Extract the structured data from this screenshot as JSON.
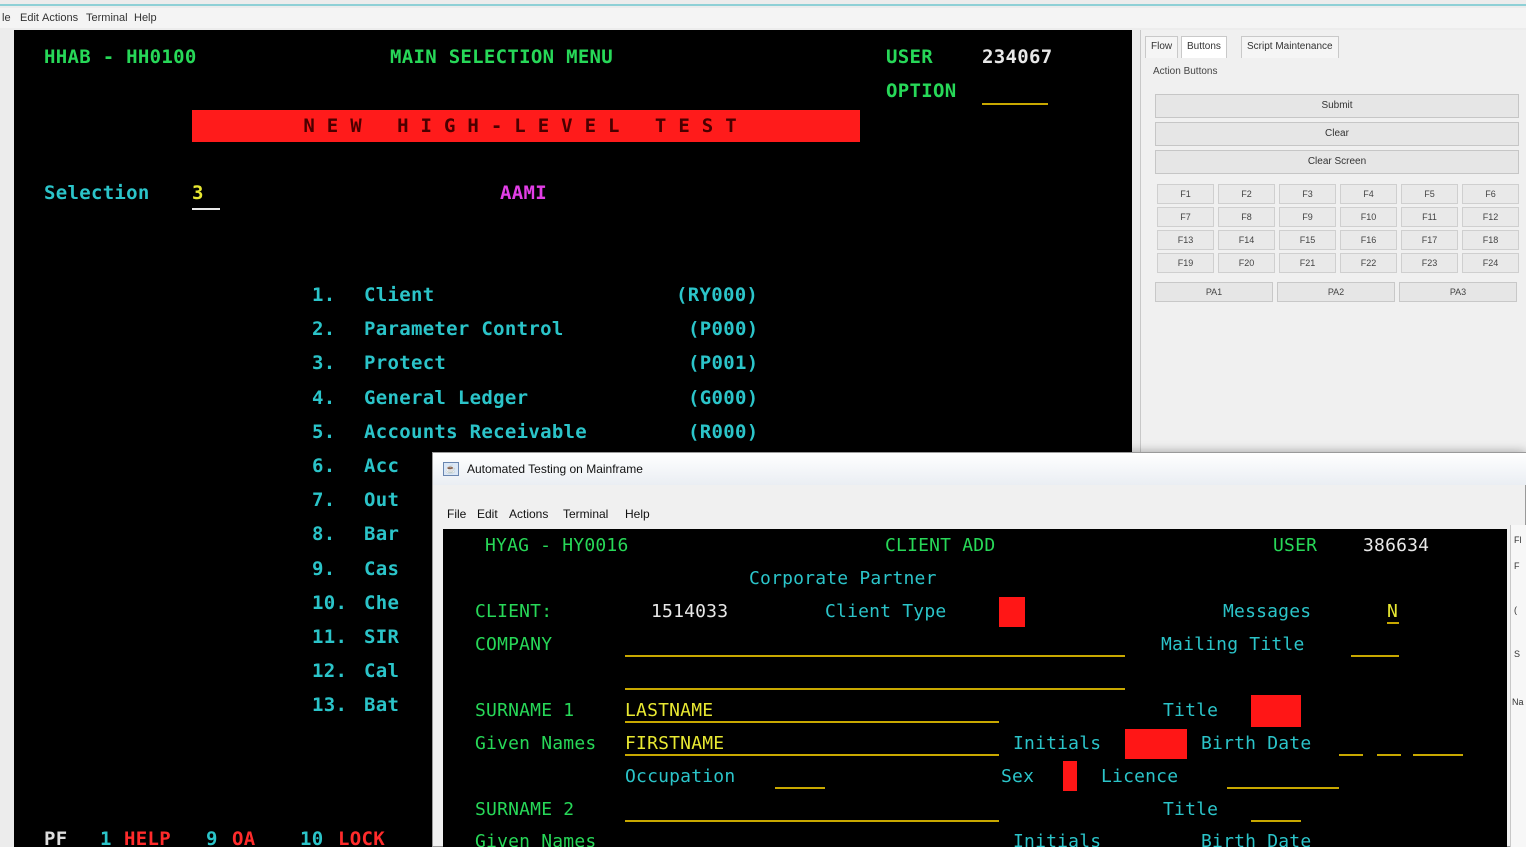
{
  "back_window": {
    "menu": [
      "le",
      "Edit",
      "Actions",
      "Terminal",
      "Help"
    ],
    "terminal": {
      "system_id": "HHAB - HH0100",
      "screen_title": "MAIN SELECTION MENU",
      "user_label": "USER",
      "user_value": "234067",
      "option_label": "OPTION",
      "banner": "NEW HIGH-LEVEL TEST",
      "selection_label": "Selection",
      "selection_value": "3",
      "aami_label": "AAMI",
      "menu_items": [
        {
          "num": "1.",
          "label": "Client",
          "code": "(RY000)"
        },
        {
          "num": "2.",
          "label": "Parameter Control",
          "code": "(P000)"
        },
        {
          "num": "3.",
          "label": "Protect",
          "code": "(P001)"
        },
        {
          "num": "4.",
          "label": "General Ledger",
          "code": "(G000)"
        },
        {
          "num": "5.",
          "label": "Accounts Receivable",
          "code": "(R000)"
        },
        {
          "num": "6.",
          "label": "Acc",
          "code": ""
        },
        {
          "num": "7.",
          "label": "Out",
          "code": ""
        },
        {
          "num": "8.",
          "label": "Bar",
          "code": ""
        },
        {
          "num": "9.",
          "label": "Cas",
          "code": ""
        },
        {
          "num": "10.",
          "label": "Che",
          "code": ""
        },
        {
          "num": "11.",
          "label": "SIR",
          "code": ""
        },
        {
          "num": "12.",
          "label": "Cal",
          "code": ""
        },
        {
          "num": "13.",
          "label": "Bat",
          "code": ""
        }
      ],
      "pf_label": "PF",
      "pf_keys": [
        {
          "num": "1",
          "label": "HELP"
        },
        {
          "num": "9",
          "label": "OA"
        },
        {
          "num": "10",
          "label": "LOCK"
        }
      ]
    },
    "panel": {
      "tabs": [
        "Flow",
        "Buttons",
        "Script Maintenance"
      ],
      "active_tab": "Buttons",
      "section_label": "Action Buttons",
      "wide_buttons": [
        "Submit",
        "Clear",
        "Clear Screen"
      ],
      "fkeys": [
        "F1",
        "F2",
        "F3",
        "F4",
        "F5",
        "F6",
        "F7",
        "F8",
        "F9",
        "F10",
        "F11",
        "F12",
        "F13",
        "F14",
        "F15",
        "F16",
        "F17",
        "F18",
        "F19",
        "F20",
        "F21",
        "F22",
        "F23",
        "F24"
      ],
      "pa_keys": [
        "PA1",
        "PA2",
        "PA3"
      ]
    }
  },
  "front_window": {
    "title": "Automated Testing on Mainframe",
    "menu": [
      "File",
      "Edit",
      "Actions",
      "Terminal",
      "Help"
    ],
    "terminal": {
      "system_id": "HYAG - HY0016",
      "screen_title": "CLIENT ADD",
      "user_label": "USER",
      "user_value": "386634",
      "subtitle": "Corporate Partner",
      "client_label": "CLIENT:",
      "client_value": "1514033",
      "client_type_label": "Client Type",
      "messages_label": "Messages",
      "messages_value": "N",
      "company_label": "COMPANY",
      "mailing_title_label": "Mailing Title",
      "surname1_label": "SURNAME 1",
      "surname1_value": "LASTNAME",
      "title_label": "Title",
      "given_names_label": "Given Names",
      "given_names_value": "FIRSTNAME",
      "initials_label": "Initials",
      "birth_date_label": "Birth Date",
      "occupation_label": "Occupation",
      "sex_label": "Sex",
      "licence_label": "Licence",
      "surname2_label": "SURNAME 2",
      "title2_label": "Title",
      "given_names2_label": "Given Names",
      "initials2_label": "Initials",
      "birth_date2_label": "Birth Date"
    },
    "side_fragments": [
      "Fl",
      "F",
      "(",
      "S",
      "Na"
    ]
  },
  "colors": {
    "terminal_bg": "#000000",
    "green": "#27d858",
    "cyan": "#2bc4c9",
    "magenta": "#e23ee6",
    "yellow": "#e8e832",
    "red": "#ff1b1b"
  }
}
